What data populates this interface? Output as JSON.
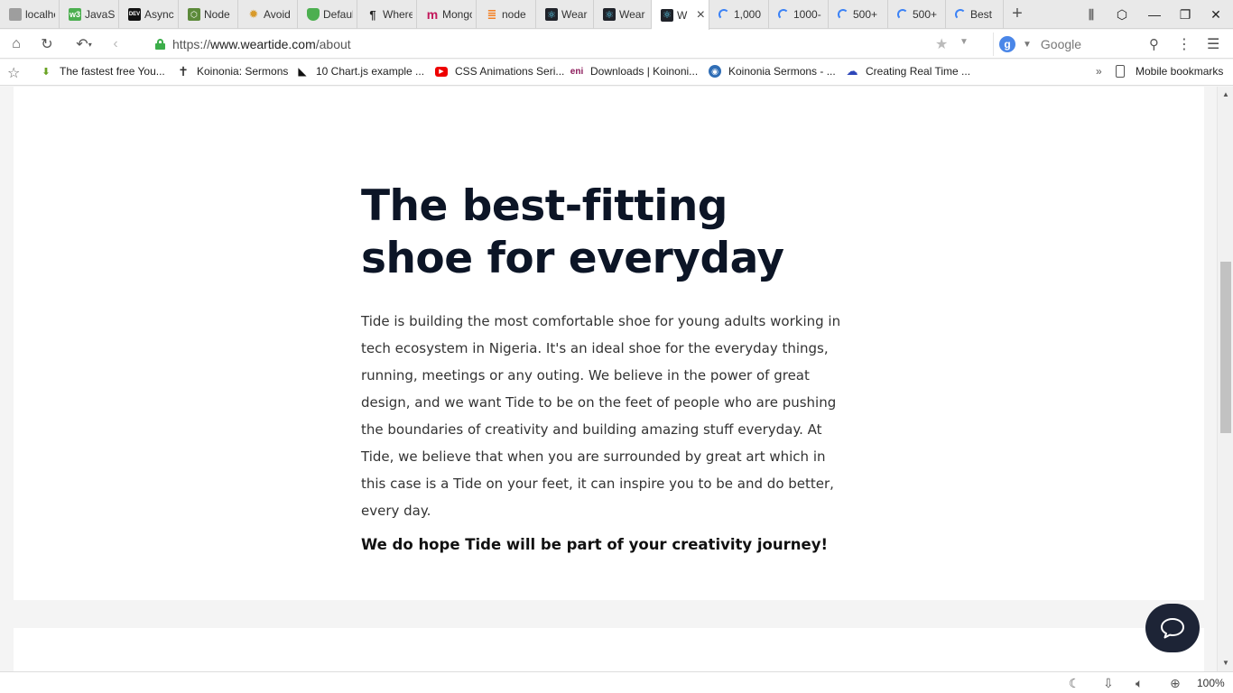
{
  "browser": {
    "tabs": [
      {
        "label": "localhost",
        "icon": "page-icon",
        "color": "#9e9e9e"
      },
      {
        "label": "JavaScript",
        "icon": "w3-icon",
        "color": "#4caf50"
      },
      {
        "label": "Async",
        "icon": "dev-icon",
        "color": "#111111"
      },
      {
        "label": "Node",
        "icon": "node-icon",
        "color": "#5c8a3a"
      },
      {
        "label": "Avoid",
        "icon": "sun-icon",
        "color": "#d89a2a"
      },
      {
        "label": "Default",
        "icon": "shield-icon",
        "color": "#4caf50"
      },
      {
        "label": "Where",
        "icon": "paragraph-icon",
        "color": "#222222"
      },
      {
        "label": "Mongo",
        "icon": "m-icon",
        "color": "#c2185b"
      },
      {
        "label": "node",
        "icon": "stack-icon",
        "color": "#f48024"
      },
      {
        "label": "Wear",
        "icon": "react-icon",
        "color": "#20232a"
      },
      {
        "label": "Wear",
        "icon": "react-icon",
        "color": "#20232a"
      },
      {
        "label": "W",
        "icon": "react-icon",
        "color": "#20232a",
        "active": true
      },
      {
        "label": "1,000",
        "icon": "spinner-icon"
      },
      {
        "label": "1000-",
        "icon": "spinner-icon"
      },
      {
        "label": "500+",
        "icon": "spinner-icon"
      },
      {
        "label": "500+",
        "icon": "spinner-icon"
      },
      {
        "label": "Best",
        "icon": "spinner-icon"
      }
    ],
    "url_scheme": "https://",
    "url_host": "www.weartide.com",
    "url_path": "/about",
    "search_engine": "Google",
    "search_engine_letter": "g",
    "bookmarks": [
      {
        "label": "The fastest free You...",
        "icon": "download-arrow-icon"
      },
      {
        "label": "Koinonia: Sermons",
        "icon": "cross-icon"
      },
      {
        "label": "10 Chart.js example ...",
        "icon": "chart-logo-icon"
      },
      {
        "label": "CSS Animations Seri...",
        "icon": "youtube-icon"
      },
      {
        "label": "Downloads | Koinoni...",
        "icon": "eni-icon"
      },
      {
        "label": "Koinonia Sermons - ...",
        "icon": "globe-icon"
      },
      {
        "label": "Creating Real Time ...",
        "icon": "cloud-icon"
      }
    ],
    "bookmarks_more": "»",
    "mobile_bookmarks": "Mobile bookmarks",
    "zoom": "100%"
  },
  "page": {
    "headline": "The best-fitting shoe for everyday",
    "body": "Tide is building the most comfortable shoe for young adults working in tech ecosystem in Nigeria. It's an ideal shoe for the everyday things, running, meetings or any outing. We believe in the power of great design, and we want Tide to be on the feet of people who are pushing the boundaries of creativity and building amazing stuff everyday. At Tide, we believe that when you are surrounded by great art which in this case is a Tide on your feet, it can inspire you to be and do better, every day.",
    "cta": "We do hope Tide will be part of your creativity journey!"
  },
  "colors": {
    "headline": "#0c1526",
    "chat_button": "#1d2436",
    "secure_lock": "#3cae4a"
  }
}
